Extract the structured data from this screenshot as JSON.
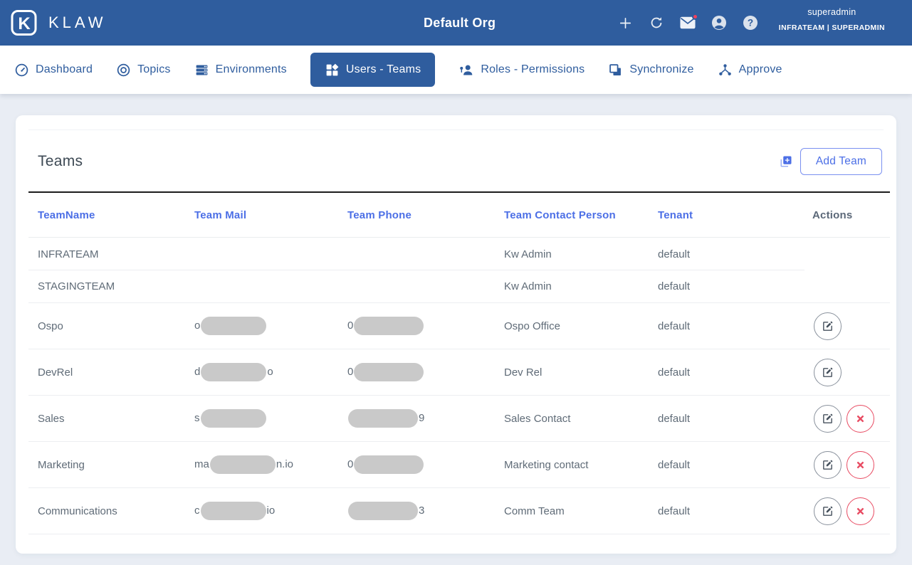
{
  "colors": {
    "header_bg": "#2f5d9e",
    "accent_blue": "#4c6fe6",
    "danger_red": "#e84c63",
    "redaction_gray": "#c9c9c9"
  },
  "header": {
    "brand": "KLAW",
    "org_title": "Default Org",
    "icons": [
      "add-icon",
      "refresh-icon",
      "mail-icon-with-badge",
      "account-icon",
      "help-icon"
    ],
    "user": {
      "username": "superadmin",
      "team_role": "INFRATEAM | SUPERADMIN"
    }
  },
  "nav": {
    "items": [
      {
        "label": "Dashboard",
        "icon": "dashboard-gauge-icon",
        "active": false
      },
      {
        "label": "Topics",
        "icon": "topics-target-icon",
        "active": false
      },
      {
        "label": "Environments",
        "icon": "environments-server-icon",
        "active": false
      },
      {
        "label": "Users - Teams",
        "icon": "users-teams-grid-icon",
        "active": true
      },
      {
        "label": "Roles - Permissions",
        "icon": "roles-permissions-icon",
        "active": false
      },
      {
        "label": "Synchronize",
        "icon": "synchronize-copy-icon",
        "active": false
      },
      {
        "label": "Approve",
        "icon": "approve-hub-icon",
        "active": false
      }
    ]
  },
  "teams_panel": {
    "title": "Teams",
    "add_team_button": "Add Team",
    "table": {
      "columns": [
        "TeamName",
        "Team Mail",
        "Team Phone",
        "Team Contact Person",
        "Tenant",
        "Actions"
      ],
      "rows": [
        {
          "team_name": "INFRATEAM",
          "mail": null,
          "phone": null,
          "contact_person": "Kw Admin",
          "tenant": "default",
          "actions": []
        },
        {
          "team_name": "STAGINGTEAM",
          "mail": null,
          "phone": null,
          "contact_person": "Kw Admin",
          "tenant": "default",
          "actions": []
        },
        {
          "team_name": "Ospo",
          "mail": {
            "prefix": "o",
            "redacted": true,
            "suffix": ""
          },
          "phone": {
            "prefix": "0",
            "redacted": true,
            "suffix": ""
          },
          "contact_person": "Ospo Office",
          "tenant": "default",
          "actions": [
            "edit"
          ]
        },
        {
          "team_name": "DevRel",
          "mail": {
            "prefix": "d",
            "redacted": true,
            "suffix": "o"
          },
          "phone": {
            "prefix": "0",
            "redacted": true,
            "suffix": ""
          },
          "contact_person": "Dev Rel",
          "tenant": "default",
          "actions": [
            "edit"
          ]
        },
        {
          "team_name": "Sales",
          "mail": {
            "prefix": "s",
            "redacted": true,
            "suffix": ""
          },
          "phone": {
            "prefix": "",
            "redacted": true,
            "suffix": "9"
          },
          "contact_person": "Sales Contact",
          "tenant": "default",
          "actions": [
            "edit",
            "delete"
          ]
        },
        {
          "team_name": "Marketing",
          "mail": {
            "prefix": "ma",
            "redacted": true,
            "suffix": "n.io"
          },
          "phone": {
            "prefix": "0",
            "redacted": true,
            "suffix": ""
          },
          "contact_person": "Marketing contact",
          "tenant": "default",
          "actions": [
            "edit",
            "delete"
          ]
        },
        {
          "team_name": "Communications",
          "mail": {
            "prefix": "c",
            "redacted": true,
            "suffix": "io"
          },
          "phone": {
            "prefix": "",
            "redacted": true,
            "suffix": "3"
          },
          "contact_person": "Comm Team",
          "tenant": "default",
          "actions": [
            "edit",
            "delete"
          ]
        }
      ]
    }
  }
}
